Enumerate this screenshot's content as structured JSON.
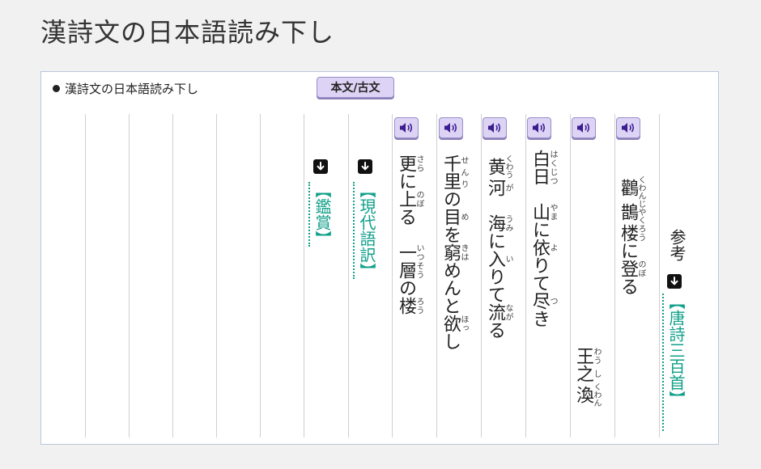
{
  "page": {
    "title": "漢詩文の日本語読み下し"
  },
  "header": {
    "label": "漢詩文の日本語読み下し",
    "toggle_label": "本文/古文"
  },
  "sections": {
    "appreciation": "【鑑賞】",
    "translation": "【現代語訳】"
  },
  "reference": {
    "label": "参考",
    "link": "【唐詩三百首】"
  },
  "poem": {
    "title": [
      {
        "text": "鸛",
        "ruby": "くわん"
      },
      {
        "text": "鵲",
        "ruby": "じやく"
      },
      {
        "text": "楼",
        "ruby": "ろう"
      },
      {
        "text": "に",
        "ruby": ""
      },
      {
        "text": "登",
        "ruby": "のぼ"
      },
      {
        "text": "る",
        "ruby": ""
      }
    ],
    "author": [
      {
        "text": "王",
        "ruby": "わう"
      },
      {
        "text": "之",
        "ruby": "し"
      },
      {
        "text": "渙",
        "ruby": "くわん"
      }
    ],
    "lines": [
      [
        {
          "text": "白日",
          "ruby": "はくじつ"
        },
        {
          "text": "　",
          "ruby": ""
        },
        {
          "text": "山",
          "ruby": "やま"
        },
        {
          "text": "に",
          "ruby": ""
        },
        {
          "text": "依",
          "ruby": "よ"
        },
        {
          "text": "りて",
          "ruby": ""
        },
        {
          "text": "尽",
          "ruby": "つ"
        },
        {
          "text": "き",
          "ruby": ""
        }
      ],
      [
        {
          "text": "黄",
          "ruby": "くわう"
        },
        {
          "text": "河",
          "ruby": "が"
        },
        {
          "text": "　",
          "ruby": ""
        },
        {
          "text": "海",
          "ruby": "うみ"
        },
        {
          "text": "に",
          "ruby": ""
        },
        {
          "text": "入",
          "ruby": "い"
        },
        {
          "text": "りて",
          "ruby": ""
        },
        {
          "text": "流",
          "ruby": "なが"
        },
        {
          "text": "る",
          "ruby": ""
        }
      ],
      [
        {
          "text": "千里",
          "ruby": "せんり"
        },
        {
          "text": "の",
          "ruby": ""
        },
        {
          "text": "目",
          "ruby": "め"
        },
        {
          "text": "を",
          "ruby": ""
        },
        {
          "text": "窮",
          "ruby": "きは"
        },
        {
          "text": "めんと",
          "ruby": ""
        },
        {
          "text": "欲",
          "ruby": "ほっ"
        },
        {
          "text": "し",
          "ruby": ""
        }
      ],
      [
        {
          "text": "更",
          "ruby": "さら"
        },
        {
          "text": "に",
          "ruby": ""
        },
        {
          "text": "上",
          "ruby": "のぼ"
        },
        {
          "text": "る",
          "ruby": ""
        },
        {
          "text": "　",
          "ruby": ""
        },
        {
          "text": "一層",
          "ruby": "いつそう"
        },
        {
          "text": "の",
          "ruby": ""
        },
        {
          "text": "楼",
          "ruby": "ろう"
        }
      ]
    ]
  },
  "icons": {
    "speaker": "speaker-icon",
    "arrow": "arrow-down-icon"
  }
}
